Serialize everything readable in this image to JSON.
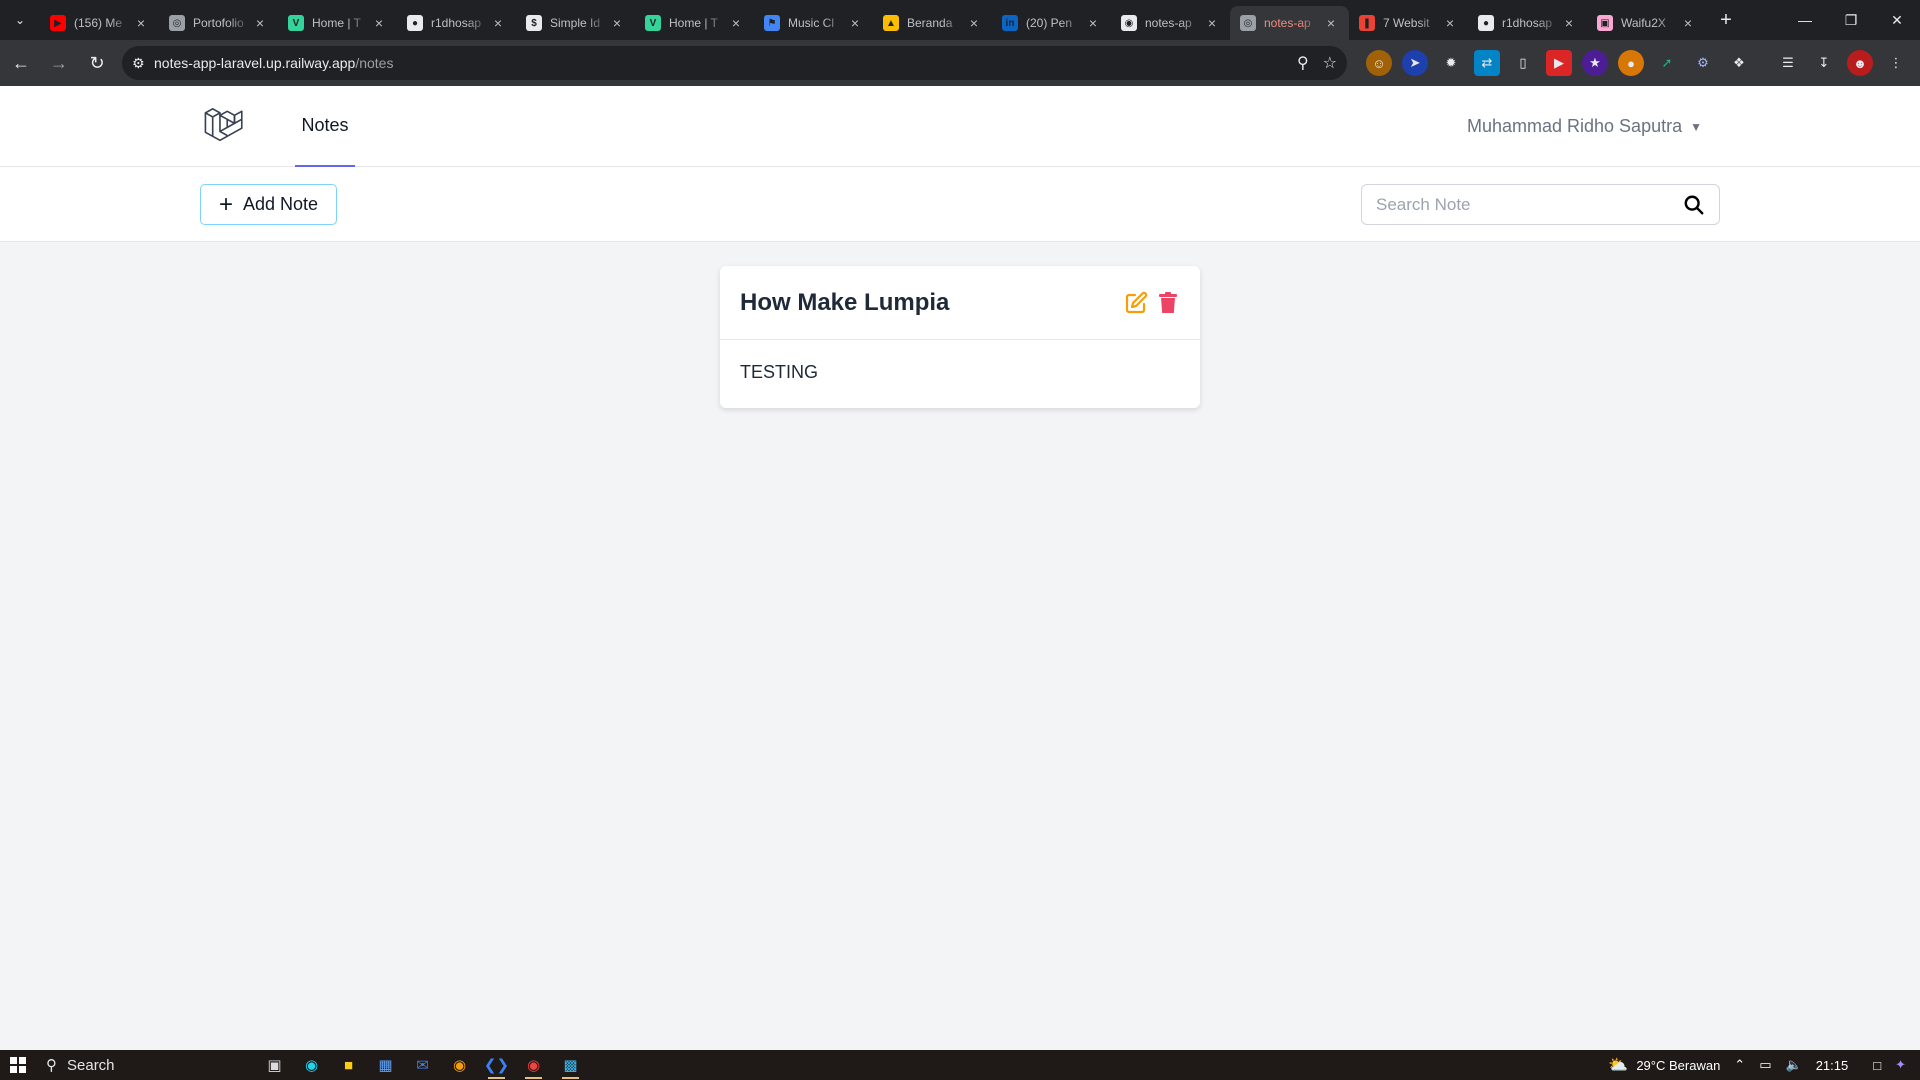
{
  "browser": {
    "tabs": [
      {
        "label": "(156) Me",
        "color": "#ff0000",
        "glyph": "▶"
      },
      {
        "label": "Portofolio",
        "color": "#9aa0a6",
        "glyph": "◎"
      },
      {
        "label": "Home | T",
        "color": "#34d399",
        "glyph": "V"
      },
      {
        "label": "r1dhosap",
        "color": "#e8eaed",
        "glyph": "●"
      },
      {
        "label": "Simple Id",
        "color": "#e8eaed",
        "glyph": "$"
      },
      {
        "label": "Home | T",
        "color": "#34d399",
        "glyph": "V"
      },
      {
        "label": "Music Cl",
        "color": "#4285f4",
        "glyph": "⚑"
      },
      {
        "label": "Beranda",
        "color": "#fbbc04",
        "glyph": "▲"
      },
      {
        "label": "(20) Pen",
        "color": "#0a66c2",
        "glyph": "in"
      },
      {
        "label": "notes-ap",
        "color": "#e8eaed",
        "glyph": "◉"
      },
      {
        "label": "notes-ap",
        "color": "#9aa0a6",
        "glyph": "◎",
        "active": true
      },
      {
        "label": "7 Websit",
        "color": "#ea4335",
        "glyph": "❚"
      },
      {
        "label": "r1dhosap",
        "color": "#e8eaed",
        "glyph": "●"
      },
      {
        "label": "Waifu2X",
        "color": "#f9a8d4",
        "glyph": "▣"
      }
    ],
    "new_tab": "+",
    "url_host": "notes-app-laravel.up.railway.app",
    "url_path": "/notes"
  },
  "app": {
    "nav_link": "Notes",
    "user_name": "Muhammad Ridho Saputra",
    "add_button": "Add Note",
    "search_placeholder": "Search Note",
    "notes": [
      {
        "title": "How Make Lumpia",
        "body": "TESTING"
      }
    ],
    "colors": {
      "edit": "#f59e0b",
      "delete": "#ef4444",
      "nav_underline": "#6366f1"
    }
  },
  "taskbar": {
    "search_label": "Search",
    "weather": "29°C  Berawan",
    "time": "21:15"
  }
}
